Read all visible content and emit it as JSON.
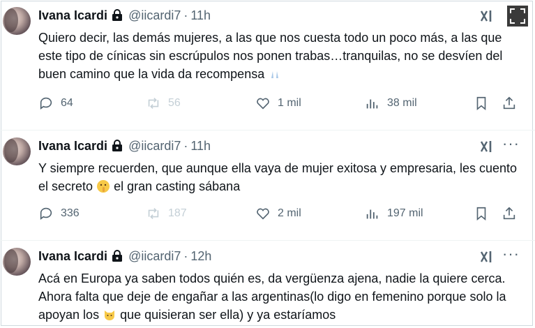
{
  "tweets": [
    {
      "author": "Ivana Icardi",
      "handle": "@iicardi7",
      "time": "11h",
      "text_before_emoji": "Quiero decir, las demás mujeres, a las que nos cuesta todo un poco más, a las que este tipo de cínicas sin escrúpulos nos ponen trabas…tranquilas, no se desvíen del buen camino que la vida da recompensa",
      "text_after_emoji": "",
      "emoji": "praying-hands",
      "replies": "64",
      "reposts": "56",
      "likes": "1 mil",
      "views": "38 mil"
    },
    {
      "author": "Ivana Icardi",
      "handle": "@iicardi7",
      "time": "11h",
      "text_before_emoji": "Y siempre recuerden, que aunque ella vaya de mujer exitosa y empresaria, les cuento el secreto",
      "text_after_emoji": "el gran casting sábana",
      "emoji": "shushing-face",
      "replies": "336",
      "reposts": "187",
      "likes": "2 mil",
      "views": "197 mil"
    },
    {
      "author": "Ivana Icardi",
      "handle": "@iicardi7",
      "time": "12h",
      "text_before_emoji": "Acá en Europa ya saben todos quién es, da vergüenza ajena, nadie la quiere cerca. Ahora falta que deje de engañar a las argentinas(lo digo en femenino porque solo la apoyan los",
      "text_after_emoji": "que quisieran ser ella) y ya estaríamos",
      "emoji": "cat-face"
    }
  ],
  "colors": {
    "text": "#0f1419",
    "muted": "#536471",
    "faint": "#c4cfd6",
    "divider": "#eff3f4"
  }
}
